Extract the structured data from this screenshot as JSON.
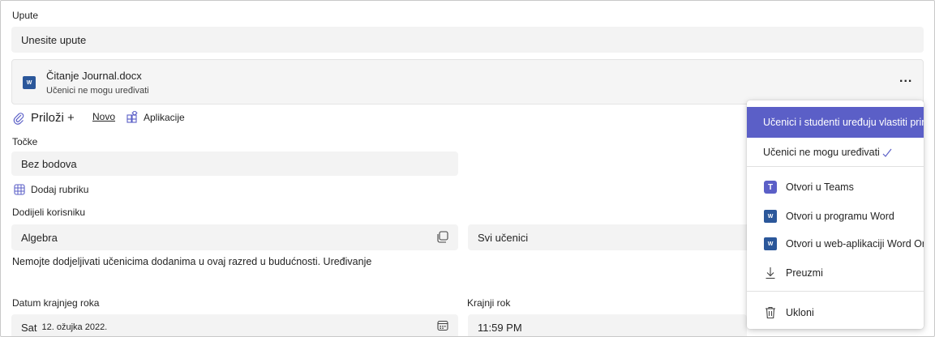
{
  "instructions": {
    "label": "Upute",
    "placeholder": "Unesite upute"
  },
  "attachment": {
    "file_name": "Čitanje Journal.docx",
    "permission": "Učenici ne mogu uređivati",
    "more": "..."
  },
  "toolbar": {
    "attach_label": "Priloži +",
    "new_label": "Novo",
    "apps_label": "Aplikacije"
  },
  "points": {
    "label": "Točke",
    "value": "Bez bodova",
    "add_rubric": "Dodaj rubriku"
  },
  "assign": {
    "label": "Dodijeli korisniku",
    "class_value": "Algebra",
    "students_value": "Svi učenici",
    "note": "Nemojte dodjeljivati učenicima dodanima u ovaj razred u budućnosti. Uređivanje"
  },
  "due_date": {
    "label": "Datum krajnjeg roka",
    "day": "Sat",
    "date": "12. ožujka 2022."
  },
  "due_time": {
    "label": "Krajnji rok",
    "value": "11:59 PM"
  },
  "menu": {
    "items": [
      {
        "label": "Učenici i studenti uređuju vlastiti primjerak",
        "icon": "none"
      },
      {
        "label": "Učenici ne mogu uređivati",
        "icon": "check-icon"
      },
      {
        "label": "Otvori u Teams",
        "icon": "teams-icon"
      },
      {
        "label": "Otvori u programu Word",
        "icon": "word-icon"
      },
      {
        "label": "Otvori u web-aplikaciji Word Online",
        "icon": "word-icon"
      },
      {
        "label": "Preuzmi",
        "icon": "download-icon"
      },
      {
        "label": "Ukloni",
        "icon": "trash-icon"
      }
    ]
  },
  "colors": {
    "accent": "#5b5fc7",
    "word": "#2b579a",
    "field_bg": "#f3f3f3"
  }
}
